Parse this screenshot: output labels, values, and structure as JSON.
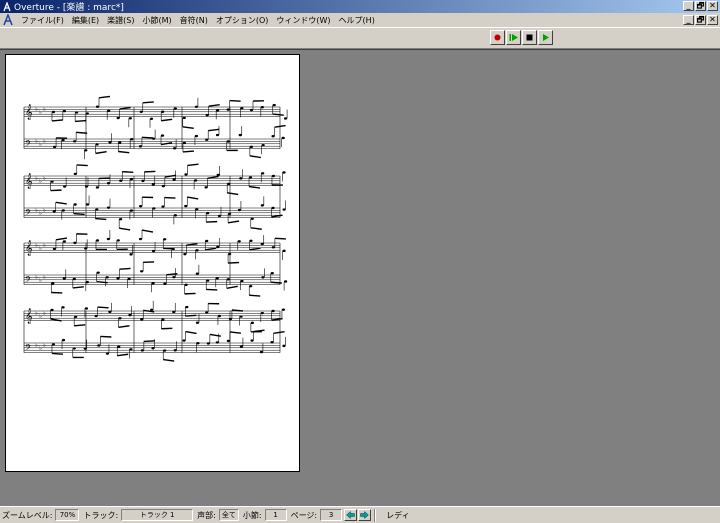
{
  "window": {
    "title": "Overture - [楽譜 : marc*]"
  },
  "window_buttons": {
    "minimize": "_",
    "maximize": "🗗",
    "close": "✕"
  },
  "menu": {
    "items": [
      {
        "label": "ファイル(F)"
      },
      {
        "label": "編集(E)"
      },
      {
        "label": "楽譜(S)"
      },
      {
        "label": "小節(M)"
      },
      {
        "label": "音符(N)"
      },
      {
        "label": "オプション(O)"
      },
      {
        "label": "ウィンドウ(W)"
      },
      {
        "label": "ヘルプ(H)"
      }
    ]
  },
  "transport": {
    "buttons": [
      {
        "name": "record",
        "icon": "record-icon",
        "color": "#c00000"
      },
      {
        "name": "play-from-start",
        "icon": "play-start-icon",
        "color": "#00a000"
      },
      {
        "name": "stop",
        "icon": "stop-icon",
        "color": "#000000"
      },
      {
        "name": "play",
        "icon": "play-icon",
        "color": "#00a000"
      }
    ]
  },
  "status": {
    "zoom_label": "ズームレベル:",
    "zoom_value": "70%",
    "track_label": "トラック:",
    "track_value": "トラック 1",
    "voice_label": "声部:",
    "voice_value": "全て",
    "measure_label": "小節:",
    "measure_value": "1",
    "page_label": "ページ:",
    "page_value": "3",
    "ready": "レディ"
  }
}
